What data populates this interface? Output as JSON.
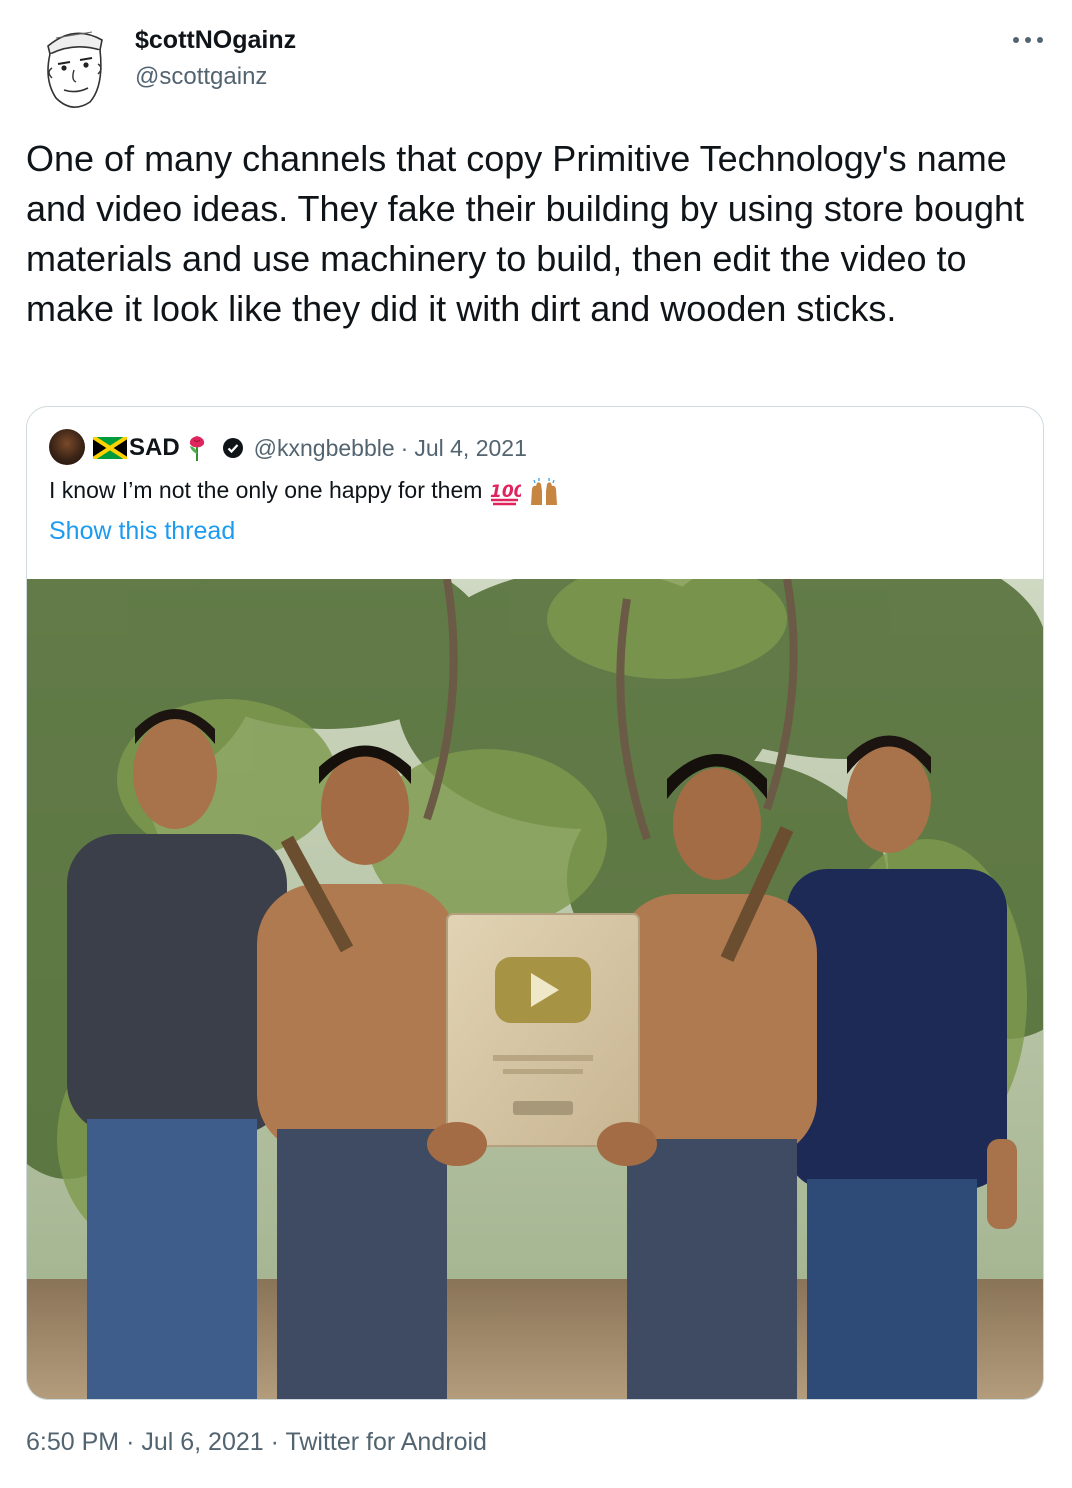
{
  "author": {
    "display_name": "$cottNOgainz",
    "handle": "@scottgainz"
  },
  "tweet": {
    "text": "One of many channels that copy Primitive Technology's name and video ideas. They fake their building by using store bought materials and use machinery to build, then edit the video to make it look like they did it with dirt and wooden sticks."
  },
  "quoted": {
    "display_name": "SAD",
    "handle": "@kxngbebble",
    "date": "Jul 4, 2021",
    "text": "I know I’m not the only one happy for them",
    "emoji": [
      "hundred-points-emoji",
      "raising-hands-emoji"
    ],
    "thread_link": "Show this thread",
    "photo": "four men in front of trees holding a YouTube play button plaque"
  },
  "footer": {
    "time": "6:50 PM",
    "date": "Jul 6, 2021",
    "source": "Twitter for Android",
    "separator": "·"
  },
  "icons": {
    "more": "more-icon",
    "verified": "verified-badge-icon",
    "flag": "jamaica-flag-icon",
    "rose": "rose-icon"
  },
  "colors": {
    "text": "#0f1419",
    "secondary": "#536471",
    "link": "#1d9bf0",
    "border": "#cfd9de"
  }
}
